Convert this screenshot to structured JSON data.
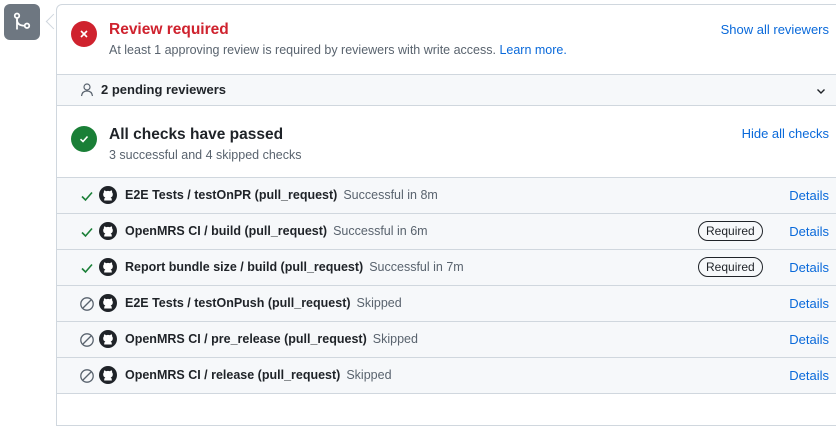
{
  "review": {
    "title": "Review required",
    "description": "At least 1 approving review is required by reviewers with write access.",
    "learn_more": "Learn more.",
    "show_all_reviewers": "Show all reviewers"
  },
  "pending": {
    "label": "2 pending reviewers"
  },
  "checks": {
    "title": "All checks have passed",
    "summary": "3 successful and 4 skipped checks",
    "hide_all": "Hide all checks",
    "details_label": "Details",
    "required_label": "Required",
    "rows": [
      {
        "name": "E2E Tests / testOnPR (pull_request)",
        "status": "Successful in 8m",
        "state": "success",
        "required": false
      },
      {
        "name": "OpenMRS CI / build (pull_request)",
        "status": "Successful in 6m",
        "state": "success",
        "required": true
      },
      {
        "name": "Report bundle size / build (pull_request)",
        "status": "Successful in 7m",
        "state": "success",
        "required": true
      },
      {
        "name": "E2E Tests / testOnPush (pull_request)",
        "status": "Skipped",
        "state": "skipped",
        "required": false
      },
      {
        "name": "OpenMRS CI / pre_release (pull_request)",
        "status": "Skipped",
        "state": "skipped",
        "required": false
      },
      {
        "name": "OpenMRS CI / release (pull_request)",
        "status": "Skipped",
        "state": "skipped",
        "required": false
      }
    ]
  },
  "colors": {
    "danger": "#cf222e",
    "success": "#1a7f37",
    "link": "#0969da",
    "muted": "#59636e"
  }
}
